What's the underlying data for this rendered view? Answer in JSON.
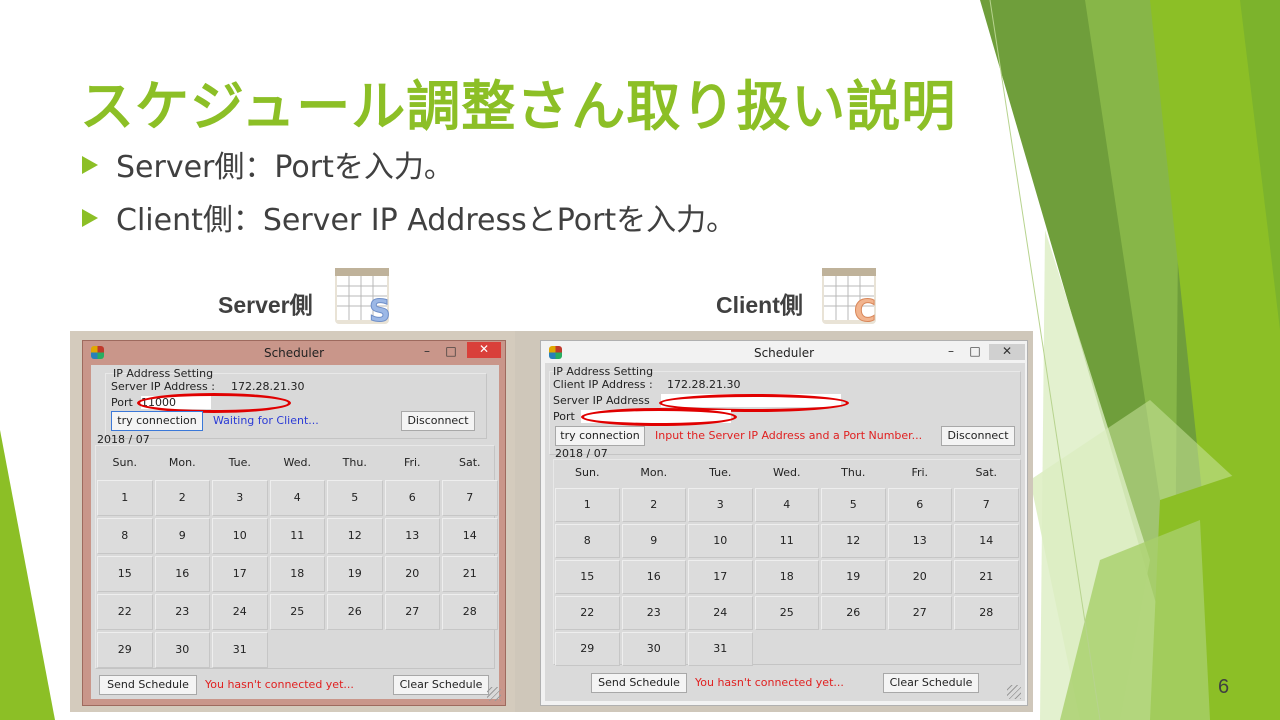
{
  "slide": {
    "title": "スケジュール調整さん取り扱い説明",
    "bullets": [
      "Server側：Portを入力。",
      "Client側：Server IP AddressとPortを入力。"
    ],
    "server_label": "Server側",
    "client_label": "Client側",
    "server_icon_letter": "S",
    "client_icon_letter": "C",
    "page_number": "6",
    "accent_color": "#8cbf26"
  },
  "server_window": {
    "title": "Scheduler",
    "group_title": "IP Address Setting",
    "server_ip_label": "Server IP Address :",
    "server_ip_value": "172.28.21.30",
    "port_label": "Port",
    "port_value": "11000",
    "try_button": "try connection",
    "status": "Waiting for Client...",
    "disconnect_button": "Disconnect",
    "month": "2018 / 07",
    "send_button": "Send Schedule",
    "bottom_status": "You hasn't connected yet...",
    "clear_button": "Clear Schedule"
  },
  "client_window": {
    "title": "Scheduler",
    "group_title": "IP Address Setting",
    "client_ip_label": "Client IP Address :",
    "client_ip_value": "172.28.21.30",
    "server_ip_label": "Server IP Address",
    "server_ip_value": "",
    "port_label": "Port",
    "port_value": "",
    "try_button": "try connection",
    "status": "Input the Server IP Address and a Port Number...",
    "disconnect_button": "Disconnect",
    "month": "2018 / 07",
    "send_button": "Send Schedule",
    "bottom_status": "You hasn't connected yet...",
    "clear_button": "Clear Schedule"
  },
  "calendar": {
    "weekdays": [
      "Sun.",
      "Mon.",
      "Tue.",
      "Wed.",
      "Thu.",
      "Fri.",
      "Sat."
    ],
    "days": [
      [
        "1",
        "2",
        "3",
        "4",
        "5",
        "6",
        "7"
      ],
      [
        "8",
        "9",
        "10",
        "11",
        "12",
        "13",
        "14"
      ],
      [
        "15",
        "16",
        "17",
        "18",
        "19",
        "20",
        "21"
      ],
      [
        "22",
        "23",
        "24",
        "25",
        "26",
        "27",
        "28"
      ],
      [
        "29",
        "30",
        "31"
      ]
    ]
  }
}
